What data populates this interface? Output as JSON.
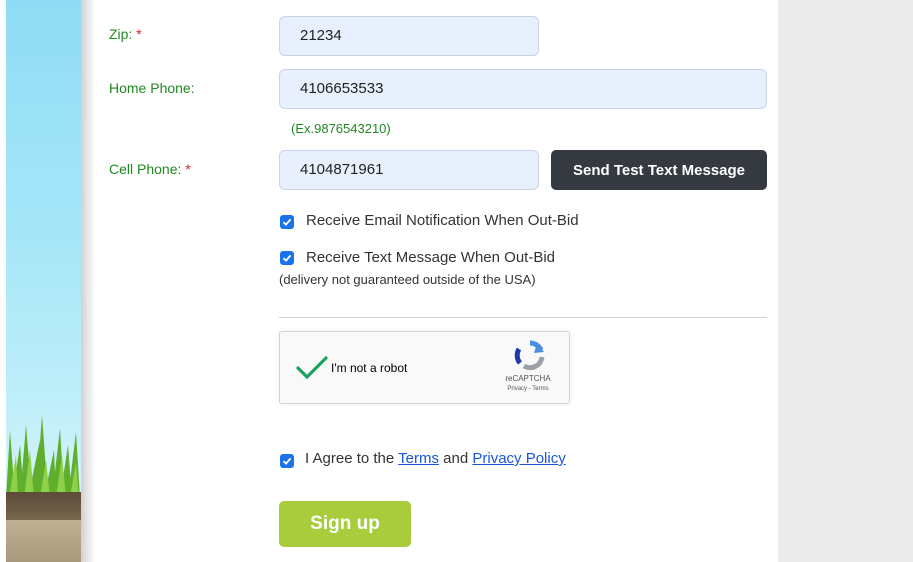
{
  "form": {
    "zip_label": "Zip:",
    "zip_required": "*",
    "zip_value": "21234",
    "home_phone_label": "Home Phone:",
    "home_phone_value": "4106653533",
    "phone_hint": "(Ex.9876543210)",
    "cell_phone_label": "Cell Phone:",
    "cell_required": "*",
    "cell_phone_value": "4104871961",
    "send_test_label": "Send Test Text Message",
    "email_notify_label": "Receive Email Notification When Out-Bid",
    "email_notify_checked": true,
    "text_notify_label": "Receive Text Message When Out-Bid",
    "text_notify_checked": true,
    "text_notify_note": "(delivery not guaranteed outside of the USA)",
    "agree_prefix": "I Agree to the",
    "agree_terms_link": "Terms",
    "agree_and": "and",
    "agree_privacy_link": "Privacy Policy",
    "agree_checked": true,
    "signup_label": "Sign up"
  },
  "captcha": {
    "label": "I'm not a robot",
    "brand": "reCAPTCHA",
    "privacy": "Privacy",
    "separator": "-",
    "terms": "Terms",
    "checked": true
  },
  "colors": {
    "label_green": "#1f8a1f",
    "required_red": "#e0202a",
    "input_bg": "#e8f0fe",
    "checkbox_blue": "#1a73e8",
    "signup_green": "#a8cc3c",
    "send_btn_bg": "#343a40"
  }
}
